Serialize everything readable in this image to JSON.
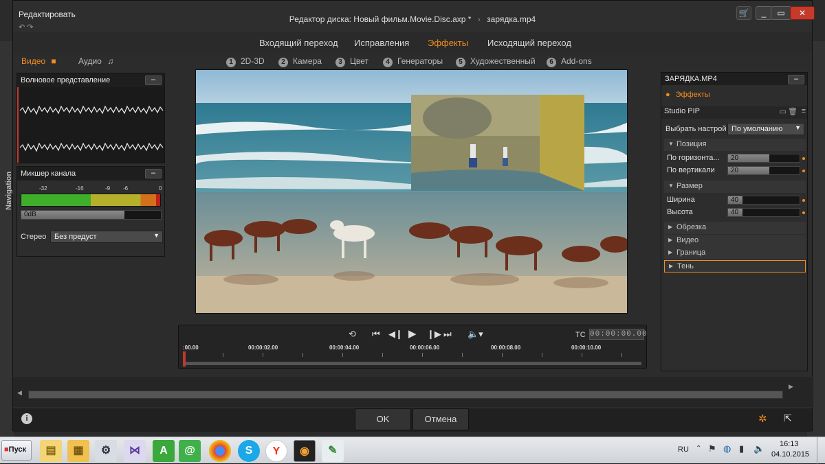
{
  "window": {
    "menu_label": "Редактировать",
    "title": "Редактор диска: Новый фильм.Movie.Disc.axp *",
    "clip_name": "зарядка.mp4",
    "nav_label": "Navigation"
  },
  "top_tabs": [
    {
      "label": "Входящий переход",
      "active": false
    },
    {
      "label": "Исправления",
      "active": false
    },
    {
      "label": "Эффекты",
      "active": true
    },
    {
      "label": "Исходящий переход",
      "active": false
    }
  ],
  "media_tabs": {
    "video": "Видео",
    "audio": "Аудио"
  },
  "effect_tabs": [
    {
      "num": "1",
      "label": "2D-3D"
    },
    {
      "num": "2",
      "label": "Камера"
    },
    {
      "num": "3",
      "label": "Цвет"
    },
    {
      "num": "4",
      "label": "Генераторы"
    },
    {
      "num": "5",
      "label": "Художественный"
    },
    {
      "num": "6",
      "label": "Add-ons"
    }
  ],
  "waveform_panel": {
    "title": "Волновое представление"
  },
  "mixer_panel": {
    "title": "Микшер канала",
    "scale": [
      "-32",
      "-16",
      "-9",
      "-6",
      "0"
    ],
    "level_label": "0dB",
    "stereo_label": "Стерео",
    "preset_value": "Без предуст"
  },
  "transport": {
    "tc_label": "TC",
    "timecode": "00:00:00.00",
    "ticks": [
      ":00.00",
      "00:00:02.00",
      "00:00:04.00",
      "00:00:06.00",
      "00:00:08.00",
      "00:00:10.00"
    ]
  },
  "right_panel": {
    "clip_title": "ЗАРЯДКА.MP4",
    "effects_label": "Эффекты",
    "effect_name": "Studio PIP",
    "choose_label": "Выбрать настрой",
    "choose_value": "По умолчанию",
    "position": {
      "section": "Позиция",
      "h_label": "По горизонта...",
      "h_value": "20",
      "v_label": "По вертикали",
      "v_value": "20"
    },
    "size": {
      "section": "Размер",
      "w_label": "Ширина",
      "w_value": "40",
      "h_label": "Высота",
      "h_value": "40"
    },
    "collapsed_sections": [
      "Обрезка",
      "Видео",
      "Граница",
      "Тень"
    ]
  },
  "buttons": {
    "ok": "OK",
    "cancel": "Отмена"
  },
  "taskbar": {
    "start": "Пуск",
    "lang": "RU",
    "time": "16:13",
    "date": "04.10.2015"
  },
  "colors": {
    "accent": "#f28c1e",
    "panel_bg": "#2d2d2d",
    "window_bg": "#2c2c2c"
  }
}
